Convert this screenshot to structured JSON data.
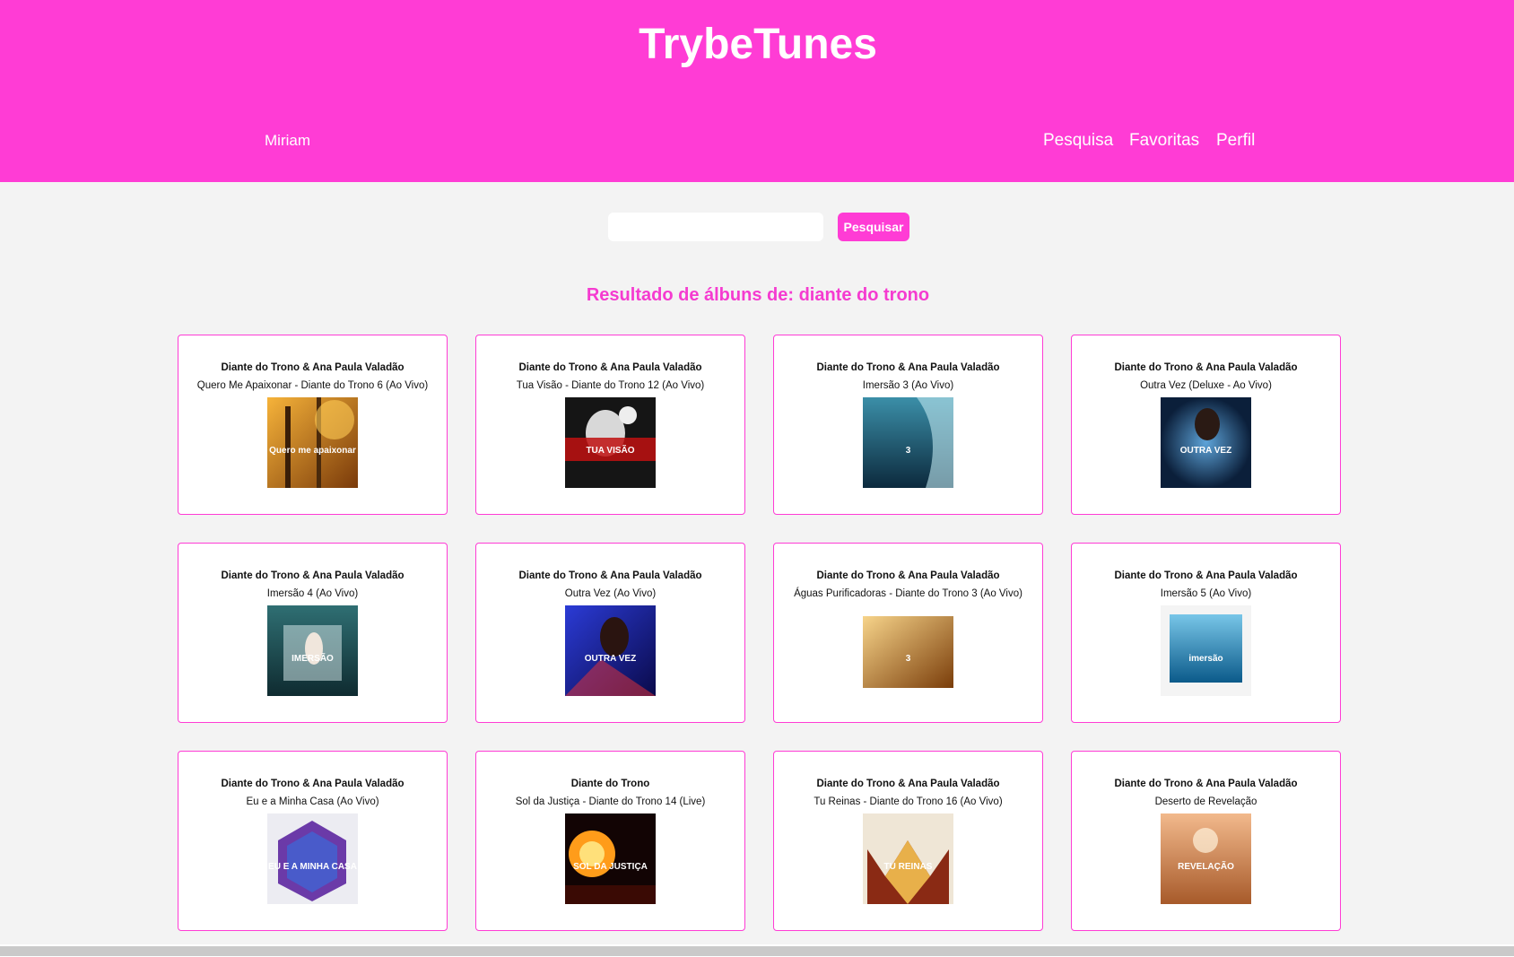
{
  "app": {
    "title": "TrybeTunes"
  },
  "header": {
    "user_name": "Miriam",
    "nav": {
      "search": "Pesquisa",
      "favorites": "Favoritas",
      "profile": "Perfil"
    }
  },
  "search": {
    "value": "",
    "placeholder": "",
    "button_label": "Pesquisar"
  },
  "results": {
    "heading_prefix": "Resultado de álbuns de:",
    "query": "diante do trono",
    "albums": [
      {
        "artist": "Diante do Trono & Ana Paula Valadão",
        "album": "Quero Me Apaixonar - Diante do Trono 6 (Ao Vivo)",
        "cover_icon": "album-cover-autumn",
        "cover_text": "Quero me apaixonar"
      },
      {
        "artist": "Diante do Trono & Ana Paula Valadão",
        "album": "Tua Visão - Diante do Trono 12 (Ao Vivo)",
        "cover_icon": "album-cover-red-singer",
        "cover_text": "TUA VISÃO"
      },
      {
        "artist": "Diante do Trono & Ana Paula Valadão",
        "album": "Imersão 3 (Ao Vivo)",
        "cover_icon": "album-cover-ocean",
        "cover_text": "3"
      },
      {
        "artist": "Diante do Trono & Ana Paula Valadão",
        "album": "Outra Vez (Deluxe - Ao Vivo)",
        "cover_icon": "album-cover-blue-singer",
        "cover_text": "OUTRA VEZ"
      },
      {
        "artist": "Diante do Trono & Ana Paula Valadão",
        "album": "Imersão 4 (Ao Vivo)",
        "cover_icon": "album-cover-water",
        "cover_text": "IMERSÃO"
      },
      {
        "artist": "Diante do Trono & Ana Paula Valadão",
        "album": "Outra Vez (Ao Vivo)",
        "cover_icon": "album-cover-stage",
        "cover_text": "OUTRA VEZ"
      },
      {
        "artist": "Diante do Trono & Ana Paula Valadão",
        "album": "Águas Purificadoras - Diante do Trono 3 (Ao Vivo)",
        "cover_icon": "album-cover-gold",
        "cover_text": "3"
      },
      {
        "artist": "Diante do Trono & Ana Paula Valadão",
        "album": "Imersão 5 (Ao Vivo)",
        "cover_icon": "album-cover-wave",
        "cover_text": "imersão"
      },
      {
        "artist": "Diante do Trono & Ana Paula Valadão",
        "album": "Eu e a Minha Casa (Ao Vivo)",
        "cover_icon": "album-cover-house",
        "cover_text": "EU E A MINHA CASA"
      },
      {
        "artist": "Diante do Trono",
        "album": "Sol da Justiça - Diante do Trono 14 (Live)",
        "cover_icon": "album-cover-sun",
        "cover_text": "SOL DA JUSTIÇA"
      },
      {
        "artist": "Diante do Trono & Ana Paula Valadão",
        "album": "Tu Reinas - Diante do Trono 16 (Ao Vivo)",
        "cover_icon": "album-cover-crown",
        "cover_text": "TU REINAS"
      },
      {
        "artist": "Diante do Trono & Ana Paula Valadão",
        "album": "Deserto de Revelação",
        "cover_icon": "album-cover-desert",
        "cover_text": "REVELAÇÃO"
      }
    ]
  },
  "colors": {
    "accent": "#ff3cd5",
    "background": "#f3f3f3",
    "card_border": "#ff3cd5"
  }
}
